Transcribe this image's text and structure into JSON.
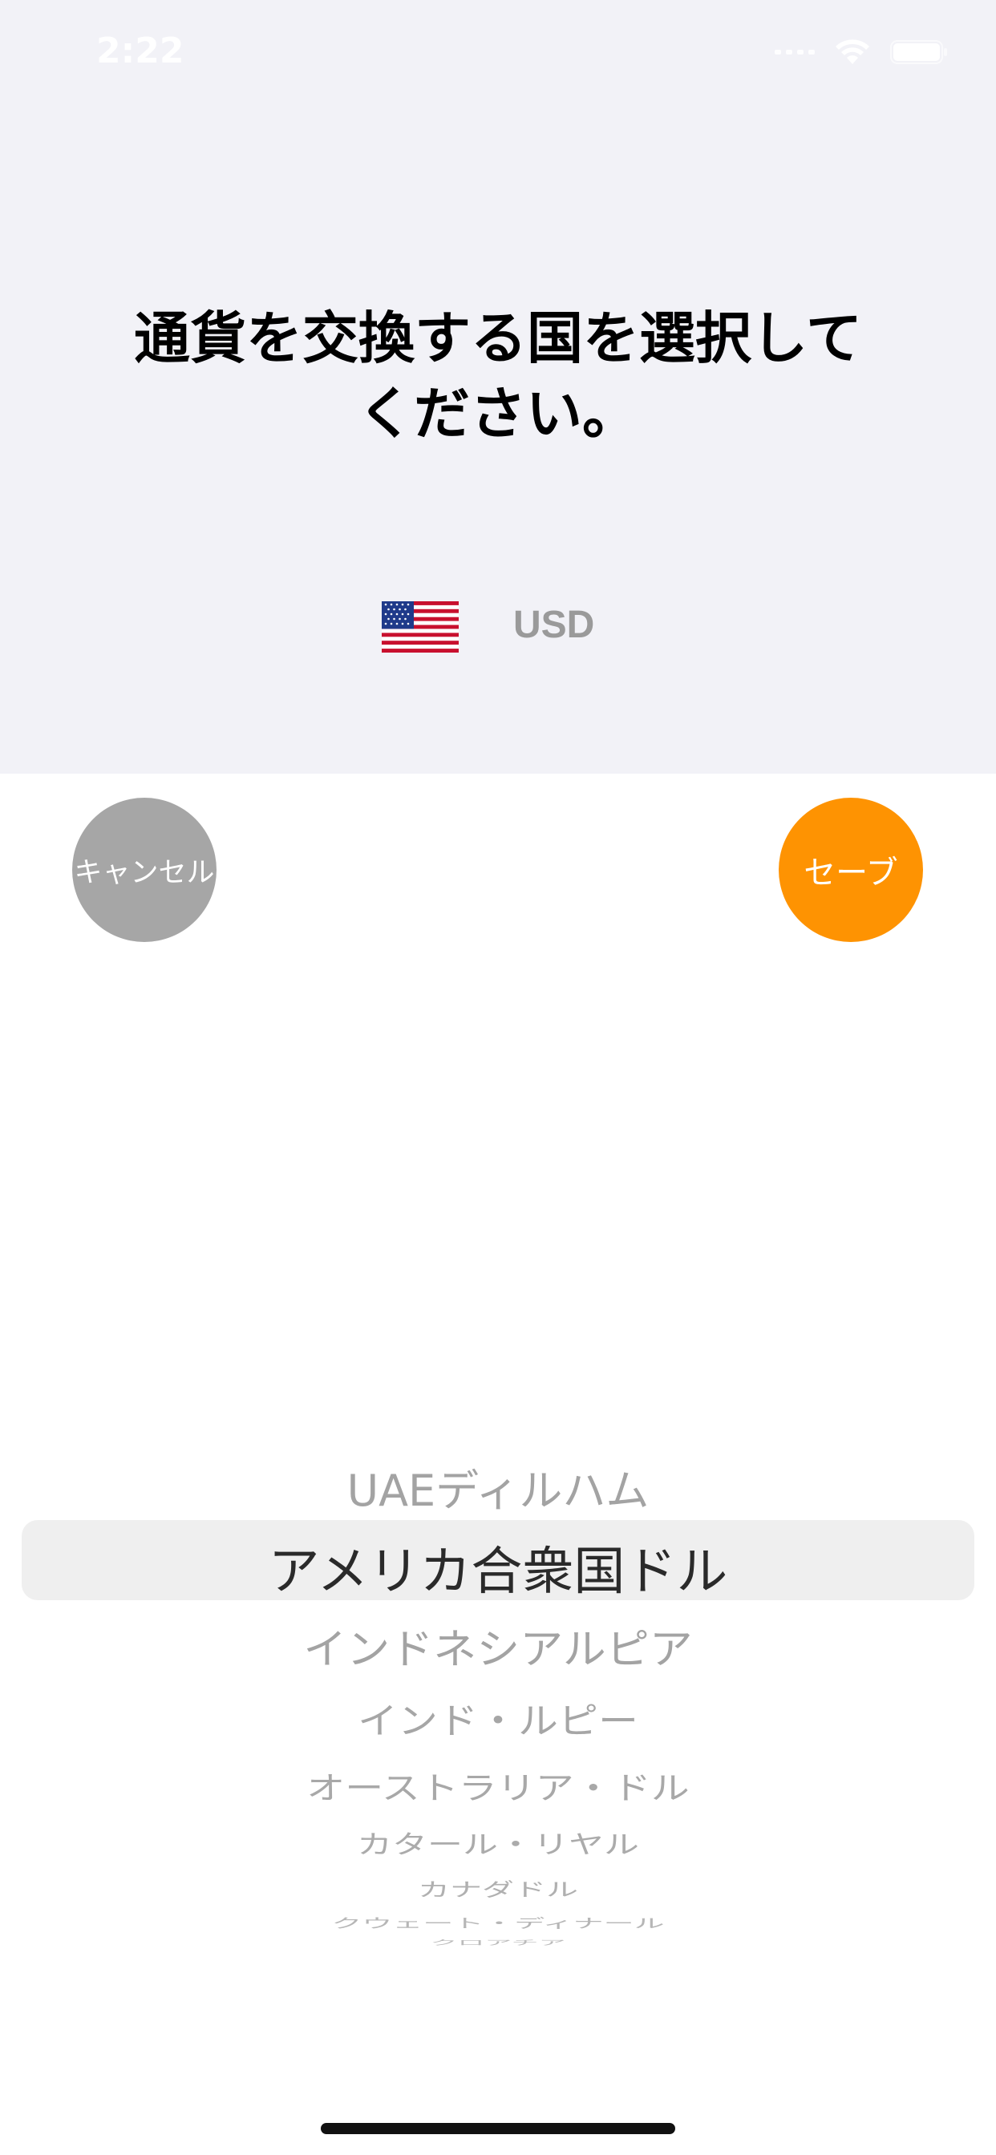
{
  "status_bar": {
    "time": "2:22"
  },
  "header": {
    "title_line1": "通貨を交換する国を選択して",
    "title_line2": "ください。"
  },
  "selection": {
    "flag_icon": "us-flag-icon",
    "currency_code": "USD"
  },
  "buttons": {
    "cancel_label": "キャンセル",
    "save_label": "セーブ"
  },
  "colors": {
    "cancel": "#a6a6a6",
    "save": "#fe9302",
    "top_panel": "#f2f2f7"
  },
  "picker": {
    "selected_index": 1,
    "items": [
      "UAEディルハム",
      "アメリカ合衆国ドル",
      "インドネシアルピア",
      "インド・ルピー",
      "オーストラリア・ドル",
      "カタール・リヤル",
      "カナダドル",
      "クウェート・ディナール",
      "クロアチア"
    ]
  }
}
